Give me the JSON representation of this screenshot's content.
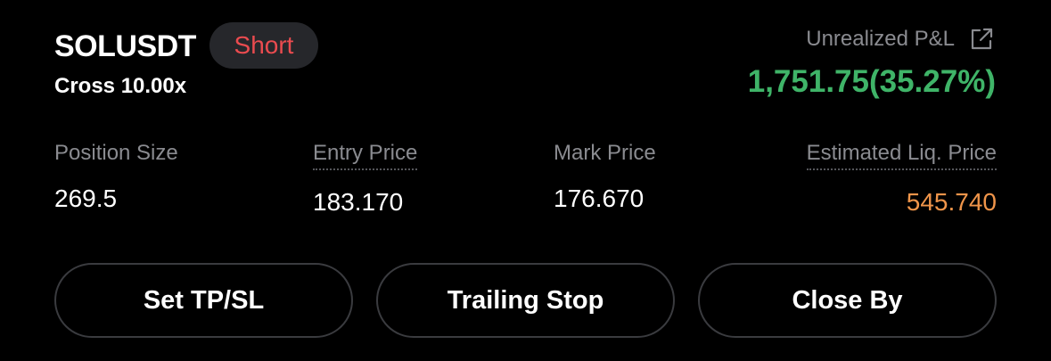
{
  "position": {
    "symbol": "SOLUSDT",
    "side": "Short",
    "leverage": "Cross 10.00x"
  },
  "pnl": {
    "label": "Unrealized P&L",
    "value": "1,751.75(35.27%)"
  },
  "stats": {
    "position_size": {
      "label": "Position Size",
      "value": "269.5"
    },
    "entry_price": {
      "label": "Entry Price",
      "value": "183.170"
    },
    "mark_price": {
      "label": "Mark Price",
      "value": "176.670"
    },
    "liq_price": {
      "label": "Estimated Liq. Price",
      "value": "545.740"
    }
  },
  "actions": {
    "tpsl": "Set TP/SL",
    "trailing_stop": "Trailing Stop",
    "close_by": "Close By"
  },
  "colors": {
    "background": "#000000",
    "short": "#ea4b4f",
    "profit": "#3fb468",
    "liquidation": "#f0954a",
    "muted": "#8a8b90"
  },
  "icons": {
    "share": "share-external-icon"
  }
}
